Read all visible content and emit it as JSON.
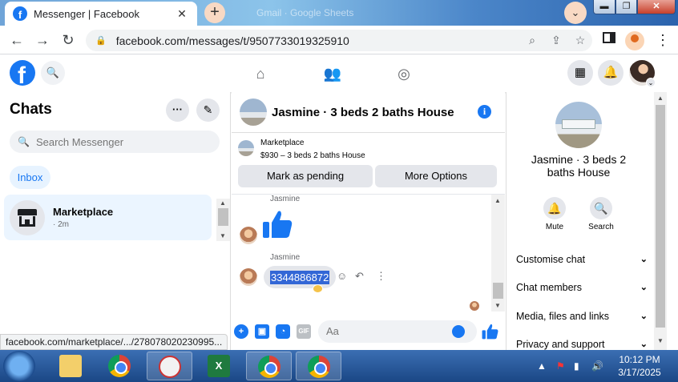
{
  "browser": {
    "tab_title": "Messenger | Facebook",
    "tab_close": "✕",
    "new_tab": "+",
    "background_tab": "Gmail · Google Sheets",
    "url": "facebook.com/messages/t/9507733019325910",
    "window_controls": {
      "minimize": "▬",
      "maximize": "❐",
      "close": "✕"
    }
  },
  "facebook_nav": {
    "icons": [
      "facebook-logo",
      "search-icon",
      "home-icon",
      "friends-icon",
      "groups-icon",
      "menu-grid-icon",
      "notifications-icon",
      "profile-avatar"
    ]
  },
  "chats_panel": {
    "title": "Chats",
    "search_placeholder": "Search Messenger",
    "inbox_label": "Inbox",
    "conversations": [
      {
        "name": "Marketplace",
        "time": "· 2m"
      }
    ]
  },
  "thread": {
    "title": "Jasmine · 3 beds 2 baths House",
    "marketplace_label": "Marketplace",
    "listing": "$930 – 3 beds 2 baths House",
    "mark_pending_label": "Mark as pending",
    "more_options_label": "More Options",
    "messages": [
      {
        "sender": "Jasmine",
        "content": "thumbs-up"
      },
      {
        "sender": "Jasmine",
        "content": "3344886872",
        "selected": true
      }
    ],
    "composer_placeholder": "Aa"
  },
  "details_panel": {
    "name": "Jasmine · 3 beds 2 baths House",
    "actions": [
      {
        "label": "Mute",
        "icon": "bell-icon"
      },
      {
        "label": "Search",
        "icon": "search-icon"
      }
    ],
    "sections": [
      "Customise chat",
      "Chat members",
      "Media, files and links",
      "Privacy and support"
    ]
  },
  "status_link": "facebook.com/marketplace/.../278078020230995...",
  "taskbar": {
    "apps": [
      "windows-explorer",
      "chrome",
      "snipping-tool",
      "excel",
      "chrome-profile",
      "chrome-profile"
    ],
    "time": "10:12 PM",
    "date": "3/17/2025"
  },
  "colors": {
    "facebook_blue": "#1877f2",
    "selected_text_bg": "#3367d6",
    "active_chat_bg": "#ebf5ff"
  }
}
